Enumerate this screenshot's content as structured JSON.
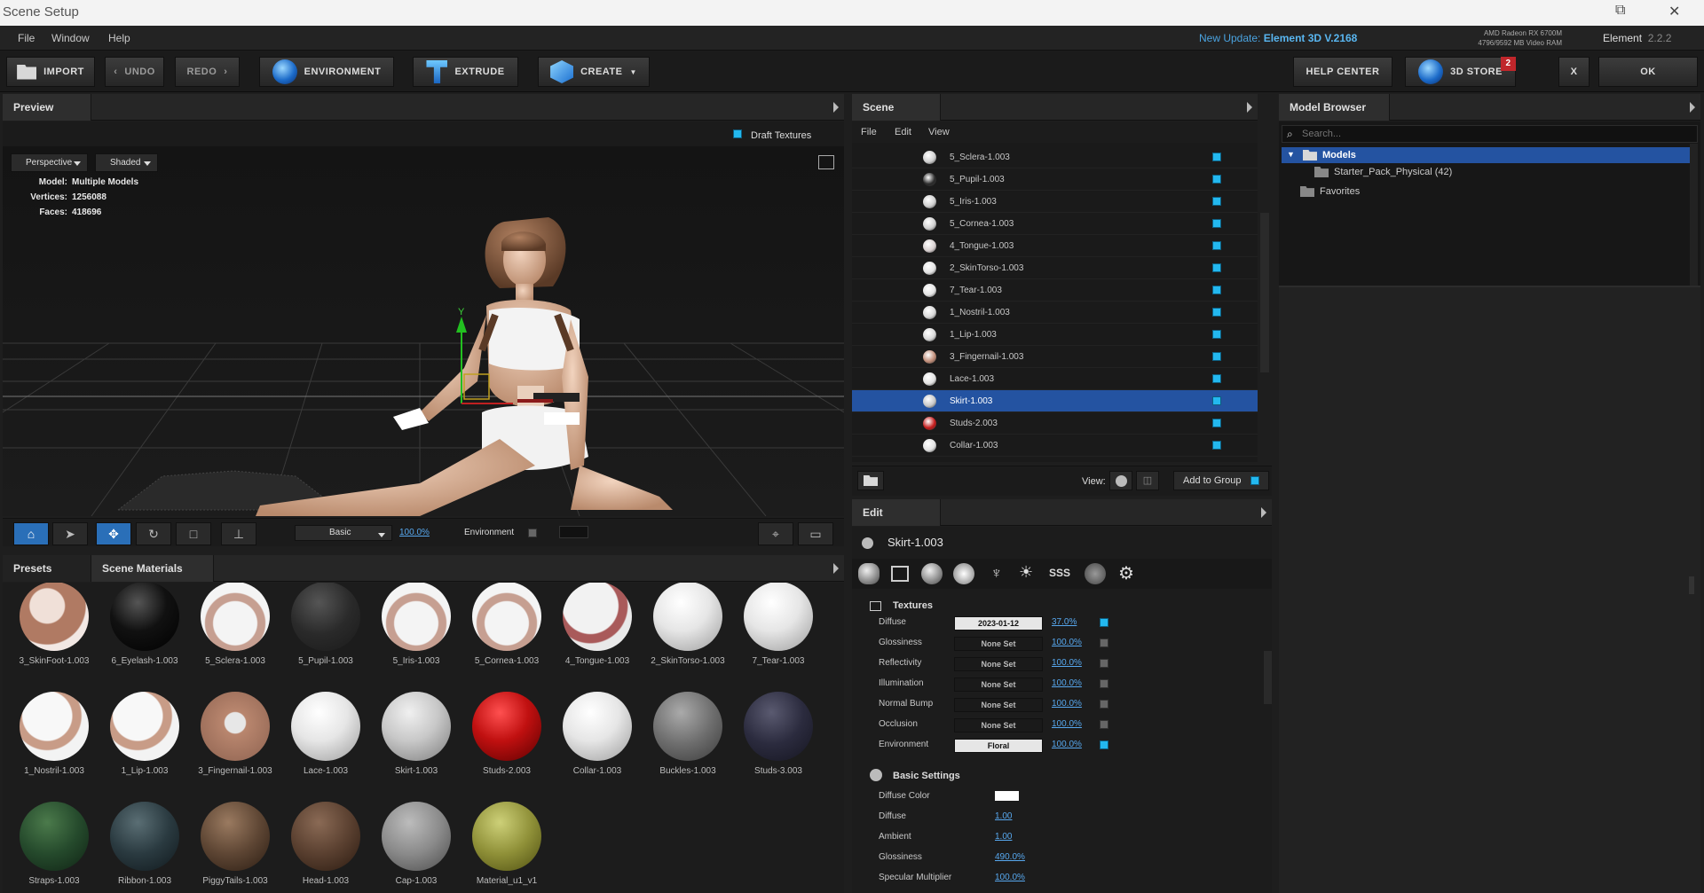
{
  "titlebar": {
    "title": "Scene Setup",
    "restore_glyph": "⧉",
    "close_glyph": "✕"
  },
  "menu": {
    "items": [
      "File",
      "Window",
      "Help"
    ],
    "update_prefix": "New Update:",
    "update_version": "Element 3D V.2168",
    "gpu_line1": "AMD Radeon RX 6700M",
    "gpu_line2": "4796/9592 MB Video RAM",
    "app_name": "Element",
    "app_version": "2.2.2"
  },
  "toolbar": {
    "import": "IMPORT",
    "undo": "UNDO",
    "redo": "REDO",
    "environment": "ENVIRONMENT",
    "extrude": "EXTRUDE",
    "create": "CREATE",
    "help_center": "HELP CENTER",
    "store": "3D STORE",
    "store_badge": "2",
    "close": "X",
    "ok": "OK"
  },
  "preview": {
    "tab": "Preview",
    "draft_textures": "Draft Textures",
    "camera": "Perspective",
    "shading": "Shaded",
    "model_label": "Model:",
    "model_value": "Multiple Models",
    "vertices_label": "Vertices:",
    "vertices_value": "1256088",
    "faces_label": "Faces:",
    "faces_value": "418696",
    "axis_y": "Y",
    "render_mode": "Basic",
    "zoom": "100.0%",
    "environment_label": "Environment"
  },
  "presets": {
    "tab_presets": "Presets",
    "tab_materials": "Scene Materials",
    "materials": [
      {
        "name": "3_SkinFoot-1.003",
        "style": "skin"
      },
      {
        "name": "6_Eyelash-1.003",
        "style": "black"
      },
      {
        "name": "5_Sclera-1.003",
        "style": "sclera"
      },
      {
        "name": "5_Pupil-1.003",
        "style": "dark"
      },
      {
        "name": "5_Iris-1.003",
        "style": "sclera"
      },
      {
        "name": "5_Cornea-1.003",
        "style": "sclera"
      },
      {
        "name": "4_Tongue-1.003",
        "style": "tongue"
      },
      {
        "name": "2_SkinTorso-1.003",
        "style": "white"
      },
      {
        "name": "7_Tear-1.003",
        "style": "white"
      },
      {
        "name": "1_Nostril-1.003",
        "style": "skinwhite"
      },
      {
        "name": "1_Lip-1.003",
        "style": "skinwhite"
      },
      {
        "name": "3_Fingernail-1.003",
        "style": "nail"
      },
      {
        "name": "Lace-1.003",
        "style": "white"
      },
      {
        "name": "Skirt-1.003",
        "style": "grey"
      },
      {
        "name": "Studs-2.003",
        "style": "red"
      },
      {
        "name": "Collar-1.003",
        "style": "white"
      },
      {
        "name": "Buckles-1.003",
        "style": "midgrey"
      },
      {
        "name": "Studs-3.003",
        "style": "navy"
      },
      {
        "name": "Straps-1.003",
        "style": "green"
      },
      {
        "name": "Ribbon-1.003",
        "style": "teal"
      },
      {
        "name": "PiggyTails-1.003",
        "style": "brown"
      },
      {
        "name": "Head-1.003",
        "style": "brown2"
      },
      {
        "name": "Cap-1.003",
        "style": "grey2"
      },
      {
        "name": "Material_u1_v1",
        "style": "olive"
      }
    ]
  },
  "scene": {
    "tab": "Scene",
    "menu": [
      "File",
      "Edit",
      "View"
    ],
    "rows": [
      {
        "name": "5_Sclera-1.003",
        "sphere": "#cfcfcf"
      },
      {
        "name": "5_Pupil-1.003",
        "sphere": "#2a2a2a"
      },
      {
        "name": "5_Iris-1.003",
        "sphere": "#cfcfcf"
      },
      {
        "name": "5_Cornea-1.003",
        "sphere": "#cfcfcf"
      },
      {
        "name": "4_Tongue-1.003",
        "sphere": "#d8d0d0"
      },
      {
        "name": "2_SkinTorso-1.003",
        "sphere": "#e2e2e2"
      },
      {
        "name": "7_Tear-1.003",
        "sphere": "#e2e2e2"
      },
      {
        "name": "1_Nostril-1.003",
        "sphere": "#d8d8d8"
      },
      {
        "name": "1_Lip-1.003",
        "sphere": "#d8d8d8"
      },
      {
        "name": "3_Fingernail-1.003",
        "sphere": "#c08d78"
      },
      {
        "name": "Lace-1.003",
        "sphere": "#e2e2e2"
      },
      {
        "name": "Skirt-1.003",
        "sphere": "#c8c8c8",
        "selected": true
      },
      {
        "name": "Studs-2.003",
        "sphere": "#c41b1b"
      },
      {
        "name": "Collar-1.003",
        "sphere": "#e2e2e2"
      }
    ],
    "view_label": "View:",
    "add_to_group": "Add to Group"
  },
  "edit": {
    "tab": "Edit",
    "object_name": "Skirt-1.003",
    "textures_title": "Textures",
    "textures": [
      {
        "label": "Diffuse",
        "slot": "2023-01-12",
        "pct": "37.0%",
        "light": true,
        "on": true
      },
      {
        "label": "Glossiness",
        "slot": "None Set",
        "pct": "100.0%",
        "light": false,
        "on": false
      },
      {
        "label": "Reflectivity",
        "slot": "None Set",
        "pct": "100.0%",
        "light": false,
        "on": false
      },
      {
        "label": "Illumination",
        "slot": "None Set",
        "pct": "100.0%",
        "light": false,
        "on": false
      },
      {
        "label": "Normal Bump",
        "slot": "None Set",
        "pct": "100.0%",
        "light": false,
        "on": false
      },
      {
        "label": "Occlusion",
        "slot": "None Set",
        "pct": "100.0%",
        "light": false,
        "on": false
      },
      {
        "label": "Environment",
        "slot": "Floral",
        "pct": "100.0%",
        "light": true,
        "on": true
      }
    ],
    "basic_title": "Basic Settings",
    "basic": [
      {
        "label": "Diffuse Color",
        "value": ""
      },
      {
        "label": "Diffuse",
        "value": "1.00"
      },
      {
        "label": "Ambient",
        "value": "1.00"
      },
      {
        "label": "Glossiness",
        "value": "490.0%"
      },
      {
        "label": "Specular Multiplier",
        "value": "100.0%"
      }
    ],
    "sss_label": "SSS"
  },
  "browser": {
    "tab": "Model Browser",
    "search_placeholder": "Search...",
    "models": "Models",
    "starter": "Starter_Pack_Physical (42)",
    "favorites": "Favorites"
  }
}
